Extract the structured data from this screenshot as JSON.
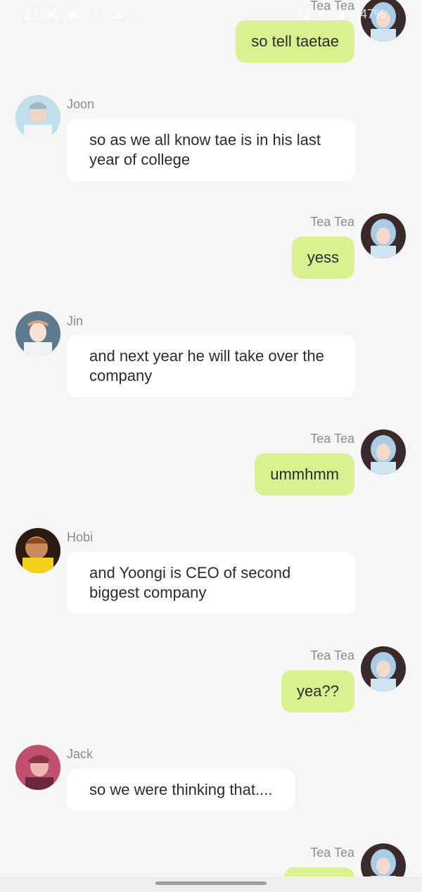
{
  "status_bar": {
    "time": "21:30",
    "left_icons": "▣ ◔ ☁ •",
    "right_icons": "▨ ▾ ◢",
    "battery": "47%"
  },
  "colors": {
    "background": "#f6f6f6",
    "outgoing_bubble": "#d8f28f",
    "incoming_bubble": "#ffffff",
    "sender_name": "#8c8c8c"
  },
  "messages": [
    {
      "direction": "out",
      "sender": "Tea Tea",
      "text": "so tell taetae",
      "avatar": "tea-tea-avatar"
    },
    {
      "direction": "in",
      "sender": "Joon",
      "text": "so as we all know tae is in his last year of college",
      "avatar": "joon-avatar"
    },
    {
      "direction": "out",
      "sender": "Tea Tea",
      "text": "yess",
      "avatar": "tea-tea-avatar"
    },
    {
      "direction": "in",
      "sender": "Jin",
      "text": "and next year he will take over the company",
      "avatar": "jin-avatar"
    },
    {
      "direction": "out",
      "sender": "Tea Tea",
      "text": "ummhmm",
      "avatar": "tea-tea-avatar"
    },
    {
      "direction": "in",
      "sender": "Hobi",
      "text": "and Yoongi is CEO of second biggest company",
      "avatar": "hobi-avatar"
    },
    {
      "direction": "out",
      "sender": "Tea Tea",
      "text": "yea??",
      "avatar": "tea-tea-avatar"
    },
    {
      "direction": "in",
      "sender": "Jack",
      "text": "so we were thinking that....",
      "avatar": "jack-avatar"
    },
    {
      "direction": "out",
      "sender": "Tea Tea",
      "text": "",
      "avatar": "tea-tea-avatar"
    }
  ]
}
